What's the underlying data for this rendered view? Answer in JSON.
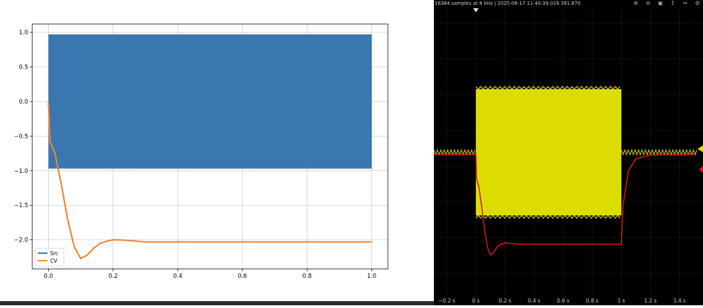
{
  "chart_data": [
    {
      "type": "line",
      "title": "",
      "xlabel": "",
      "ylabel": "",
      "xlim": [
        -0.05,
        1.05
      ],
      "ylim": [
        -2.42,
        1.12
      ],
      "xticks": [
        "0.0",
        "0.2",
        "0.4",
        "0.6",
        "0.8",
        "1.0"
      ],
      "yticks": [
        "1.0",
        "0.5",
        "0.0",
        "−0.5",
        "−1.0",
        "−1.5",
        "−2.0"
      ],
      "grid": true,
      "legend": {
        "position": "lower-left"
      },
      "series": [
        {
          "name": "Src",
          "color": "#3a76af",
          "band": {
            "x0": 0.0,
            "x1": 1.0,
            "low": -0.97,
            "high": 0.97
          }
        },
        {
          "name": "CV",
          "color": "#ef8636",
          "x": [
            0.0,
            0.005,
            0.02,
            0.04,
            0.06,
            0.08,
            0.1,
            0.12,
            0.14,
            0.16,
            0.18,
            0.2,
            0.22,
            0.25,
            0.3,
            0.35,
            0.4,
            0.5,
            0.6,
            0.7,
            0.8,
            0.9,
            1.0
          ],
          "y": [
            0.0,
            -0.58,
            -0.75,
            -1.2,
            -1.72,
            -2.1,
            -2.27,
            -2.22,
            -2.12,
            -2.05,
            -2.02,
            -2.0,
            -2.0,
            -2.01,
            -2.03,
            -2.03,
            -2.03,
            -2.03,
            -2.03,
            -2.03,
            -2.03,
            -2.03,
            -2.03
          ]
        }
      ]
    },
    {
      "type": "line",
      "title": "",
      "xlim": [
        -0.35,
        1.5
      ],
      "ylim": [
        -1.4,
        1.4
      ],
      "xticks": [
        "−0.2 s",
        "0 s",
        "0.2 s",
        "0.4 s",
        "0.6 s",
        "0.8 s",
        "1 s",
        "1.2 s",
        "1.4 s"
      ],
      "grid": true,
      "series": [
        {
          "name": "",
          "color": "#dcdc00",
          "band": {
            "x0": 0.0,
            "x1": 1.0,
            "low": -1.0,
            "high": 1.0
          },
          "baseline": 0.0
        },
        {
          "name": "",
          "color": "#d01c1c",
          "x": [
            -0.35,
            0.0,
            0.005,
            0.02,
            0.04,
            0.06,
            0.08,
            0.1,
            0.12,
            0.14,
            0.16,
            0.2,
            0.3,
            0.5,
            0.8,
            0.99,
            1.0,
            1.01,
            1.05,
            1.1,
            1.2,
            1.5
          ],
          "y": [
            -0.05,
            -0.05,
            -0.58,
            -0.75,
            -1.2,
            -1.72,
            -2.1,
            -2.27,
            -2.22,
            -2.12,
            -2.05,
            -2.0,
            -2.03,
            -2.03,
            -2.03,
            -2.03,
            -2.03,
            -1.2,
            -0.4,
            -0.15,
            -0.06,
            -0.05
          ]
        }
      ]
    }
  ],
  "scope": {
    "status": "16384 samples at 8 kHz  |  2025-06-17 11:40:39.029.391.870",
    "icons": [
      "zoom-in-icon",
      "zoom-out-icon",
      "zoom-fit-icon",
      "zoom-vertical-icon",
      "zoom-horizontal-icon",
      "settings-icon"
    ]
  }
}
